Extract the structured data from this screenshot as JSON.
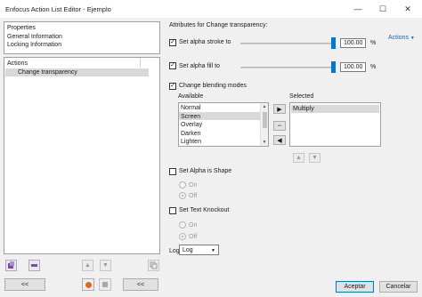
{
  "window": {
    "title": "Enfocus Action List Editor - Ejemplo",
    "minimize_glyph": "—",
    "maximize_glyph": "☐",
    "close_glyph": "✕"
  },
  "properties": {
    "items": [
      "Properties",
      "General Information",
      "Locking Information"
    ]
  },
  "actions": {
    "header": "Actions",
    "items": [
      "Change transparency"
    ]
  },
  "attributes": {
    "heading": "Attributes for Change transparency:",
    "actions_link": "Actions",
    "stroke": {
      "label": "Set alpha stroke to",
      "value": "100.00",
      "unit": "%",
      "checked": true,
      "level": 1.0
    },
    "fill": {
      "label": "Set alpha fill to",
      "value": "100.00",
      "unit": "%",
      "checked": true,
      "level": 1.0
    },
    "blend": {
      "label": "Change blending modes",
      "checked": true,
      "available_label": "Available",
      "selected_label": "Selected",
      "available": [
        "Normal",
        "Screen",
        "Overlay",
        "Darken",
        "Lighten"
      ],
      "available_highlight": "Screen",
      "selected": [
        "Multiply"
      ]
    },
    "alpha_shape": {
      "label": "Set Alpha is Shape",
      "on": "On",
      "off": "Off",
      "checked": false
    },
    "knockout": {
      "label": "Set Text Knockout",
      "on": "On",
      "off": "Off",
      "checked": false
    },
    "log": {
      "label": "Log",
      "value": "Log"
    }
  },
  "buttons": {
    "collapse_left": "<<",
    "collapse_right": "<<",
    "accept": "Aceptar",
    "cancel": "Cancelar",
    "move_right": "▶",
    "move_left": "◀",
    "swap": "⇔",
    "up": "▲",
    "down": "▼"
  },
  "icons": {
    "record_color": "#e8641e",
    "accent": "#0078d7",
    "link_color": "#1e5fb3"
  }
}
